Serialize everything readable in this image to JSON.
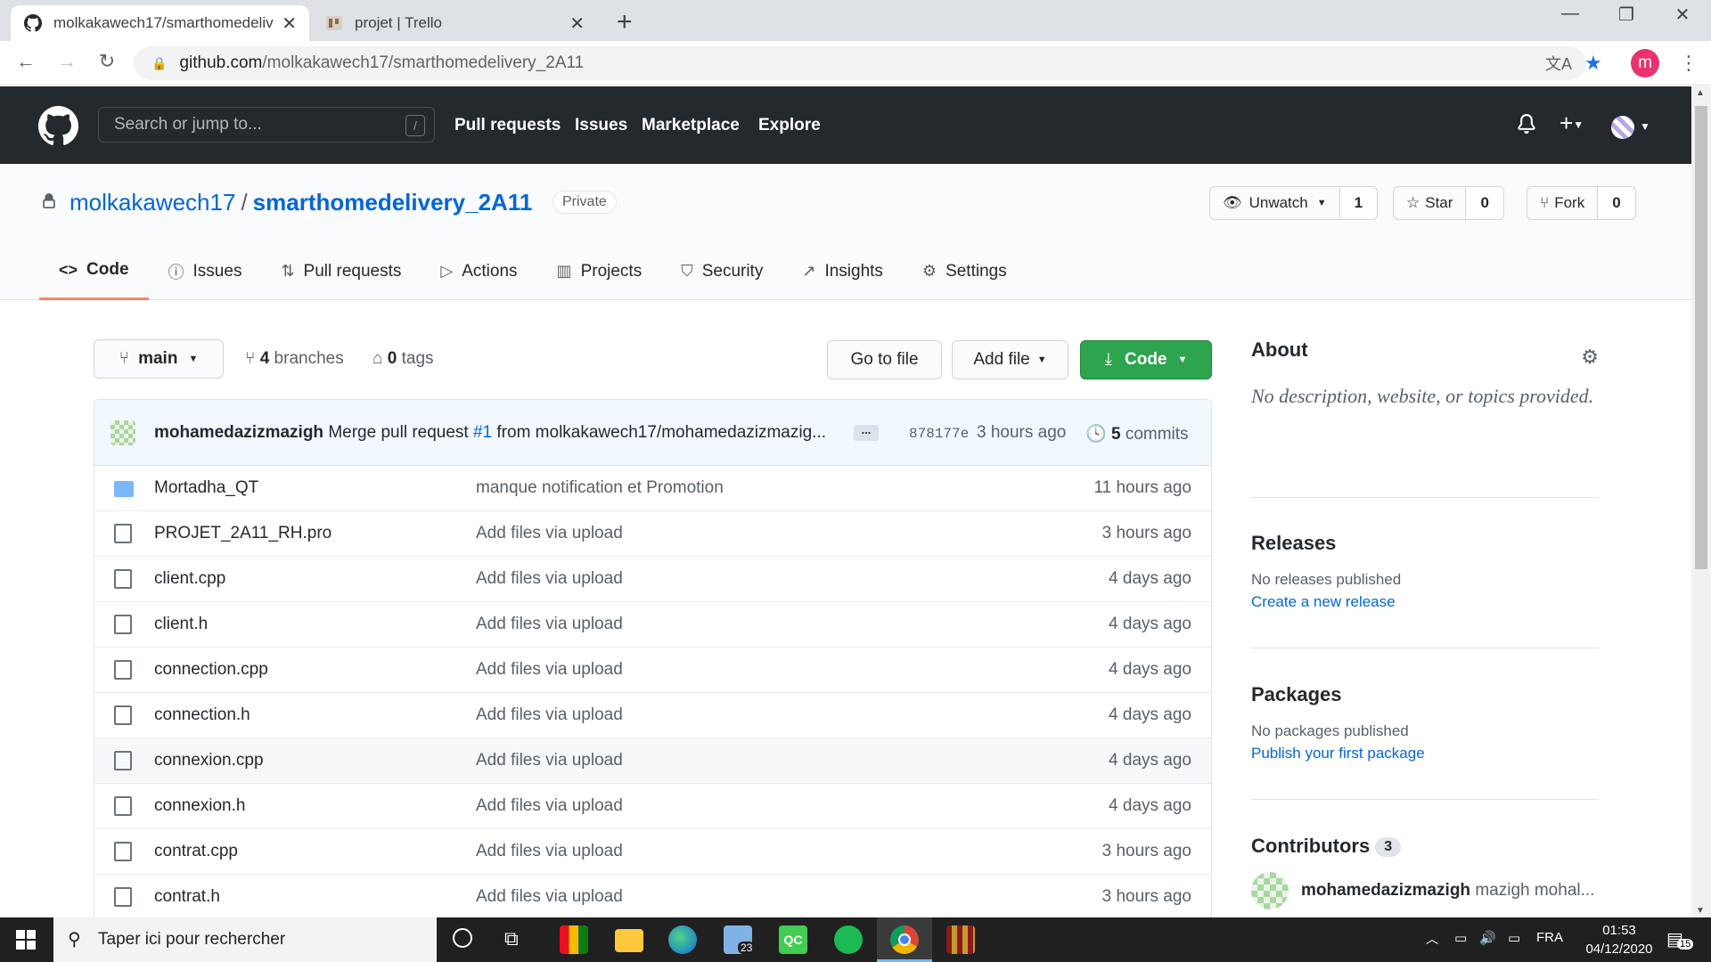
{
  "browser": {
    "tabs": [
      {
        "title": "molkakawech17/smarthomedeliv",
        "active": true
      },
      {
        "title": "projet | Trello",
        "active": false
      }
    ],
    "url_host": "github.com",
    "url_path": "/molkakawech17/smarthomedelivery_2A11",
    "profile_initial": "m"
  },
  "gh": {
    "search_placeholder": "Search or jump to...",
    "search_key": "/",
    "nav": [
      "Pull requests",
      "Issues",
      "Marketplace",
      "Explore"
    ]
  },
  "repo": {
    "owner": "molkakawech17",
    "sep": "/",
    "name": "smarthomedelivery_2A11",
    "visibility": "Private",
    "watch_label": "Unwatch",
    "watch_count": "1",
    "star_label": "Star",
    "star_count": "0",
    "fork_label": "Fork",
    "fork_count": "0",
    "tabs": [
      "Code",
      "Issues",
      "Pull requests",
      "Actions",
      "Projects",
      "Security",
      "Insights",
      "Settings"
    ]
  },
  "filenav": {
    "branch": "main",
    "branches_count": "4",
    "branches_label": "branches",
    "tags_count": "0",
    "tags_label": "tags",
    "go_to_file": "Go to file",
    "add_file": "Add file",
    "code": "Code"
  },
  "commit": {
    "author": "mohamedazizmazigh",
    "msg_prefix": "Merge pull request",
    "pr": "#1",
    "msg_suffix": "from molkakawech17/mohamedazizmazig...",
    "dots": "...",
    "sha": "878177e",
    "time": "3 hours ago",
    "count": "5",
    "count_label": "commits"
  },
  "files": [
    {
      "name": "Mortadha_QT",
      "type": "dir",
      "msg": "manque notification et Promotion",
      "age": "11 hours ago"
    },
    {
      "name": "PROJET_2A11_RH.pro",
      "type": "file",
      "msg": "Add files via upload",
      "age": "3 hours ago"
    },
    {
      "name": "client.cpp",
      "type": "file",
      "msg": "Add files via upload",
      "age": "4 days ago"
    },
    {
      "name": "client.h",
      "type": "file",
      "msg": "Add files via upload",
      "age": "4 days ago"
    },
    {
      "name": "connection.cpp",
      "type": "file",
      "msg": "Add files via upload",
      "age": "4 days ago"
    },
    {
      "name": "connection.h",
      "type": "file",
      "msg": "Add files via upload",
      "age": "4 days ago"
    },
    {
      "name": "connexion.cpp",
      "type": "file",
      "msg": "Add files via upload",
      "age": "4 days ago"
    },
    {
      "name": "connexion.h",
      "type": "file",
      "msg": "Add files via upload",
      "age": "4 days ago"
    },
    {
      "name": "contrat.cpp",
      "type": "file",
      "msg": "Add files via upload",
      "age": "3 hours ago"
    },
    {
      "name": "contrat.h",
      "type": "file",
      "msg": "Add files via upload",
      "age": "3 hours ago"
    }
  ],
  "sidebar": {
    "about_title": "About",
    "about_desc": "No description, website, or topics provided.",
    "releases_title": "Releases",
    "releases_none": "No releases published",
    "releases_link": "Create a new release",
    "packages_title": "Packages",
    "packages_none": "No packages published",
    "packages_link": "Publish your first package",
    "contributors_title": "Contributors",
    "contributors_count": "3",
    "contributor_login": "mohamedazizmazigh",
    "contributor_name": "mazigh mohal..."
  },
  "taskbar": {
    "search_placeholder": "Taper ici pour rechercher",
    "mail_badge": "23",
    "lang": "FRA",
    "time": "01:53",
    "date": "04/12/2020",
    "notif_count": "15"
  },
  "colors": {
    "gh_header": "#24292e",
    "link": "#0366d6",
    "green": "#2ea44f",
    "tab_underline": "#f9826c"
  }
}
